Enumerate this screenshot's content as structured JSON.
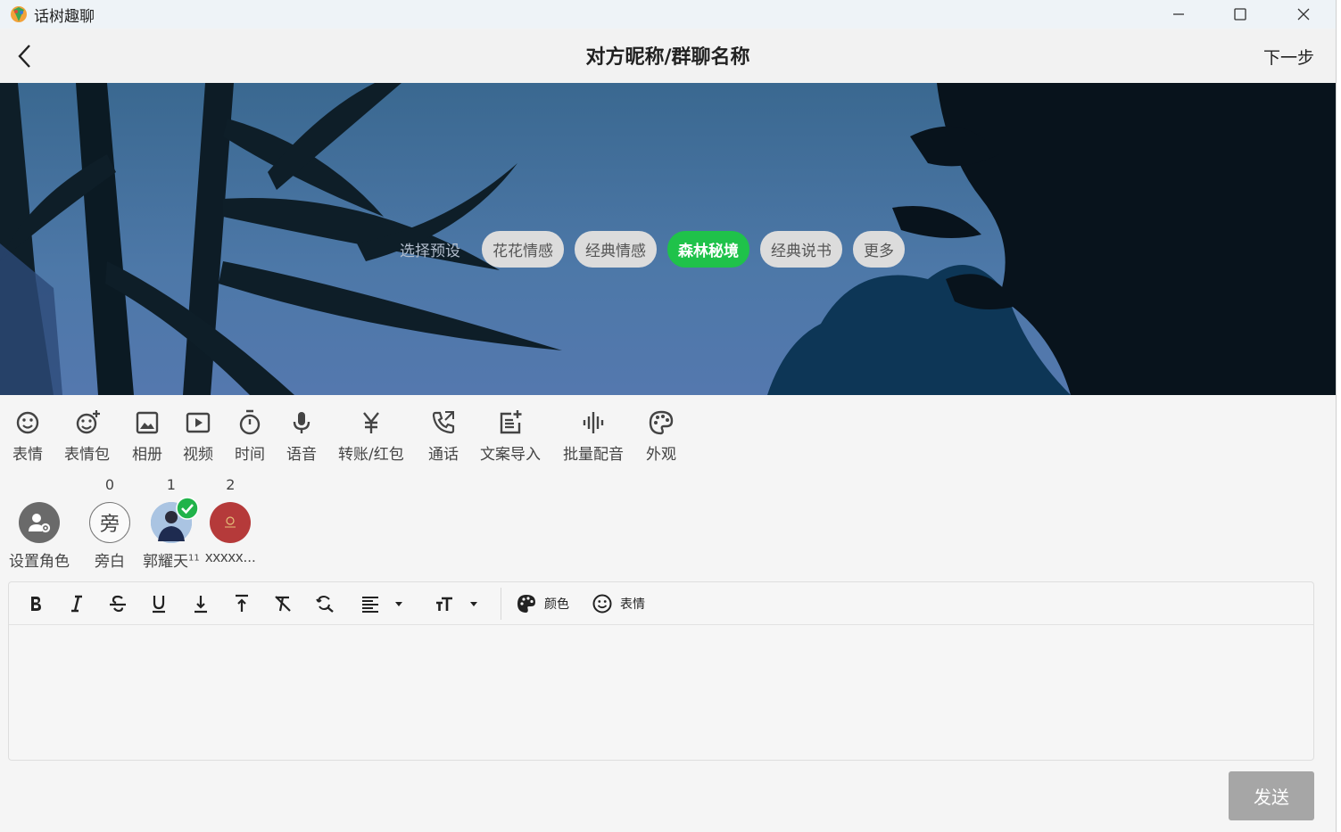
{
  "window": {
    "app_title": "话树趣聊",
    "minimize_icon": "minimize-icon",
    "maximize_icon": "maximize-icon",
    "close_icon": "close-icon"
  },
  "header": {
    "title": "对方昵称/群聊名称",
    "next_label": "下一步"
  },
  "banner": {
    "preset_label": "选择预设",
    "presets": [
      {
        "label": "花花情感",
        "active": false
      },
      {
        "label": "经典情感",
        "active": false
      },
      {
        "label": "森林秘境",
        "active": true
      },
      {
        "label": "经典说书",
        "active": false
      },
      {
        "label": "更多",
        "active": false
      }
    ]
  },
  "tools": [
    {
      "label": "表情",
      "icon": "smile-icon"
    },
    {
      "label": "表情包",
      "icon": "sticker-add-icon"
    },
    {
      "label": "相册",
      "icon": "image-icon"
    },
    {
      "label": "视频",
      "icon": "video-icon"
    },
    {
      "label": "时间",
      "icon": "timer-icon"
    },
    {
      "label": "语音",
      "icon": "mic-icon"
    },
    {
      "label": "转账/红包",
      "icon": "yuan-icon"
    },
    {
      "label": "通话",
      "icon": "call-icon"
    },
    {
      "label": "文案导入",
      "icon": "post-add-icon"
    },
    {
      "label": "批量配音",
      "icon": "waveform-icon"
    },
    {
      "label": "外观",
      "icon": "palette-icon"
    }
  ],
  "roles": [
    {
      "num": "",
      "name": "设置角色",
      "avatar": "role-settings-icon"
    },
    {
      "num": "0",
      "name": "旁白",
      "avatar_text": "旁"
    },
    {
      "num": "1",
      "name": "郭耀天",
      "sup": "11",
      "avatar": "photo-avatar",
      "selected": true
    },
    {
      "num": "2",
      "name": "xxxxx...",
      "avatar": "red-avatar"
    }
  ],
  "editor": {
    "color_label": "颜色",
    "emoji_label": "表情",
    "buttons": [
      "bold-icon",
      "italic-icon",
      "strikethrough-icon",
      "underline-icon",
      "subscript-icon",
      "superscript-icon",
      "clear-format-icon",
      "find-replace-icon",
      "align-left-icon",
      "font-size-icon",
      "palette-icon",
      "smile-icon"
    ]
  },
  "send_label": "发送",
  "colors": {
    "accent": "#1fc24a",
    "send_disabled": "#a6a6a6",
    "role_red": "#b53a3a"
  }
}
